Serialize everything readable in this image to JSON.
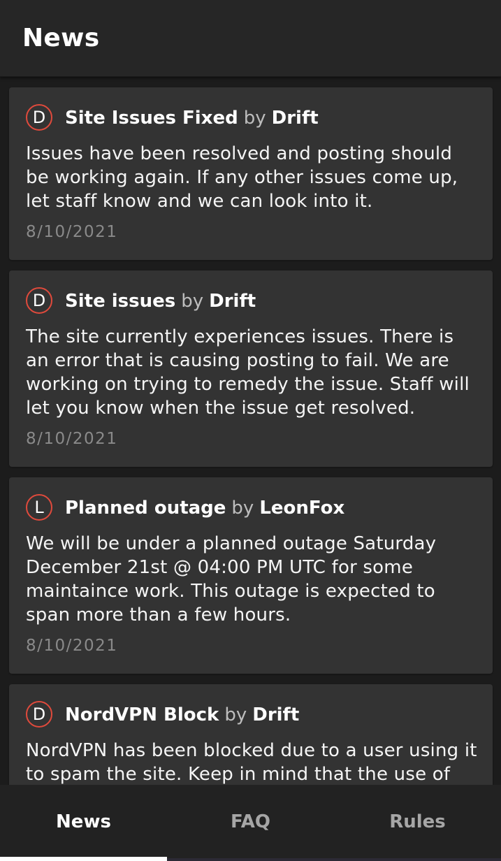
{
  "appbar": {
    "title": "News"
  },
  "colors": {
    "accent": "#e04a3c",
    "background": "#1c1c1c",
    "card": "#333333"
  },
  "news": [
    {
      "avatar": "D",
      "title": "Site Issues Fixed",
      "by": "by",
      "author": "Drift",
      "body": "Issues have been resolved and posting should be working again. If any other issues come up, let staff know and we can look into it.",
      "date": "8/10/2021"
    },
    {
      "avatar": "D",
      "title": "Site issues",
      "by": "by",
      "author": "Drift",
      "body": "The site currently experiences issues. There is an error that is causing posting to fail. We are working on trying to remedy the issue. Staff will let you know when the issue get resolved.",
      "date": "8/10/2021"
    },
    {
      "avatar": "L",
      "title": "Planned outage",
      "by": "by",
      "author": "LeonFox",
      "body": "We will be under a planned outage Saturday December 21st @ 04:00 PM UTC for some maintaince work. This outage is expected to span more than a few hours.",
      "date": "8/10/2021"
    },
    {
      "avatar": "D",
      "title": "NordVPN Block",
      "by": "by",
      "author": "Drift",
      "body": "NordVPN has been blocked due to a user using it to spam the site. Keep in mind that the use of proxies",
      "date": ""
    }
  ],
  "bottom_nav": {
    "tabs": [
      {
        "label": "News",
        "active": true
      },
      {
        "label": "FAQ",
        "active": false
      },
      {
        "label": "Rules",
        "active": false
      }
    ]
  }
}
